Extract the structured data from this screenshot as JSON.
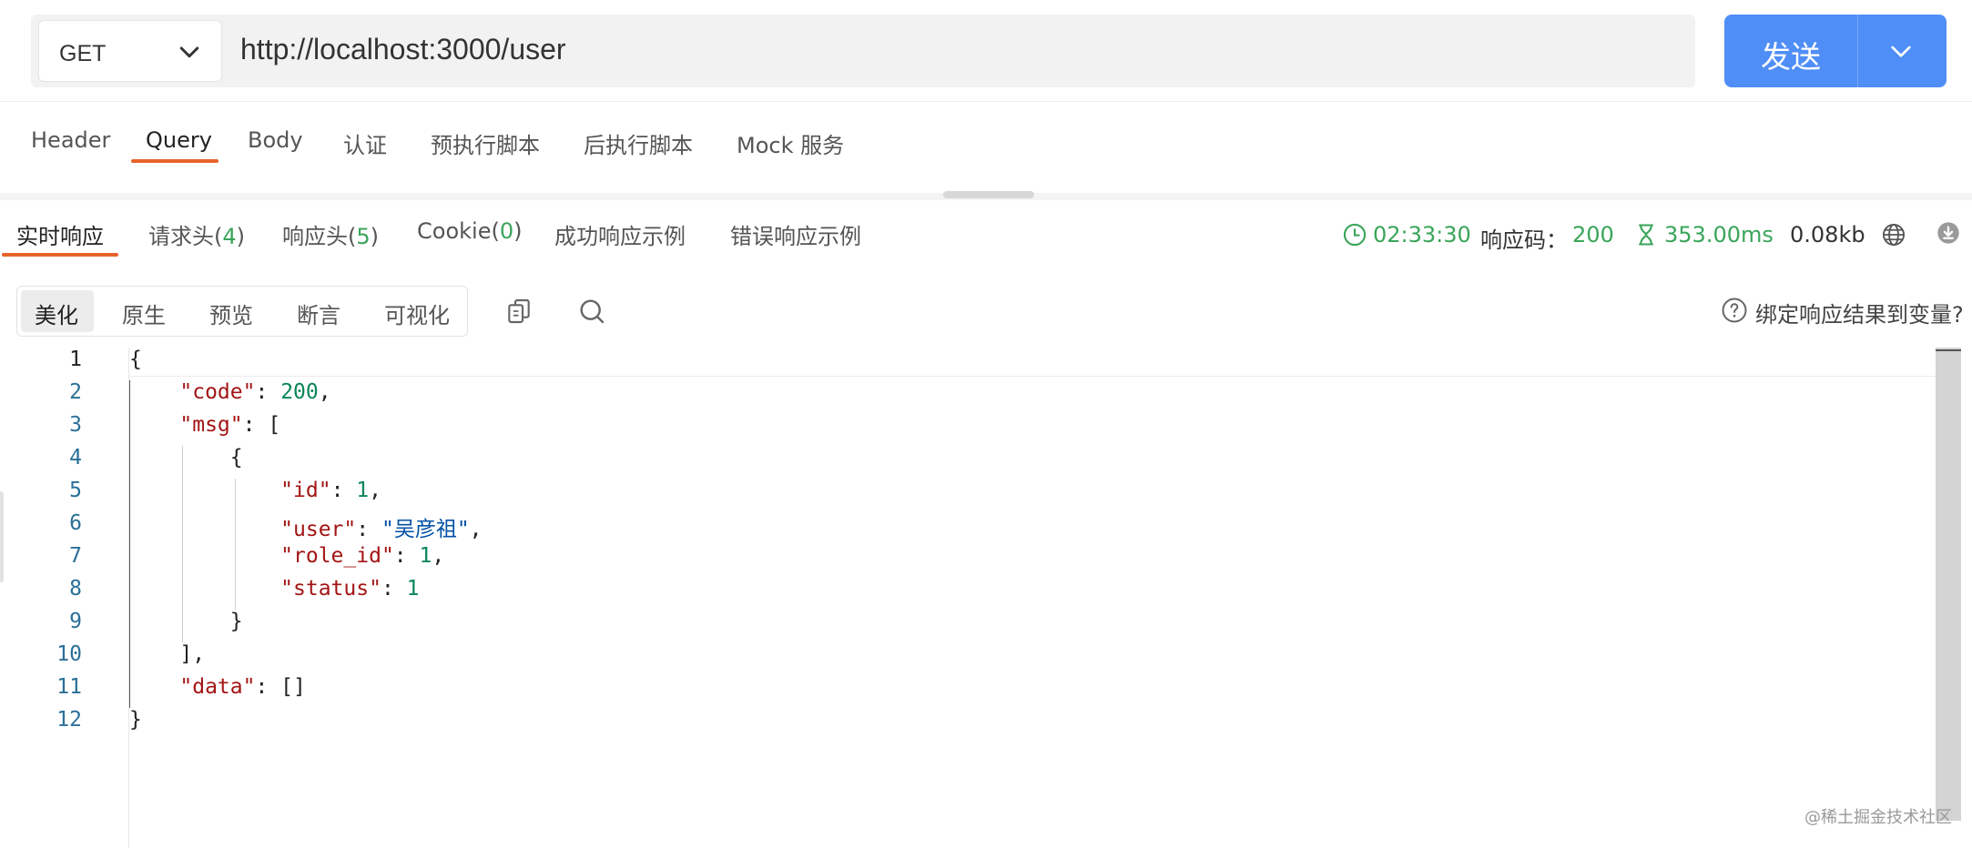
{
  "request": {
    "method": "GET",
    "url": "http://localhost:3000/user",
    "send_label": "发送"
  },
  "request_tabs": [
    "Header",
    "Query",
    "Body",
    "认证",
    "预执行脚本",
    "后执行脚本",
    "Mock 服务"
  ],
  "request_tab_active": "Query",
  "response_tabs": {
    "realtime": "实时响应",
    "req_headers": "请求头(",
    "req_headers_count": "4",
    "resp_headers": "响应头(",
    "resp_headers_count": "5",
    "cookie": "Cookie(",
    "cookie_count": "0",
    "close_paren": ")",
    "success_example": "成功响应示例",
    "error_example": "错误响应示例"
  },
  "response_meta": {
    "time": "02:33:30",
    "status_label": "响应码：",
    "status_code": "200",
    "duration": "353.00ms",
    "size": "0.08kb"
  },
  "view_modes": [
    "美化",
    "原生",
    "预览",
    "断言",
    "可视化"
  ],
  "view_mode_active": "美化",
  "bind_label": "绑定响应结果到变量?",
  "editor": {
    "line_numbers": [
      "1",
      "2",
      "3",
      "4",
      "5",
      "6",
      "7",
      "8",
      "9",
      "10",
      "11",
      "12"
    ],
    "current_line": "1",
    "tokens": {
      "code_key": "\"code\"",
      "code_val": "200",
      "msg_key": "\"msg\"",
      "id_key": "\"id\"",
      "id_val": "1",
      "user_key": "\"user\"",
      "user_val": "\"吴彦祖\"",
      "role_key": "\"role_id\"",
      "role_val": "1",
      "status_key": "\"status\"",
      "status_val": "1",
      "data_key": "\"data\""
    }
  },
  "watermark": "@稀土掘金技术社区",
  "colors": {
    "accent": "#e8632a",
    "primary": "#4f8ef7",
    "success": "#3aa55a"
  },
  "icons": [
    "chevron-down-icon",
    "clock-icon",
    "hourglass-icon",
    "globe-icon",
    "download-icon",
    "copy-icon",
    "search-icon",
    "help-circle-icon"
  ]
}
